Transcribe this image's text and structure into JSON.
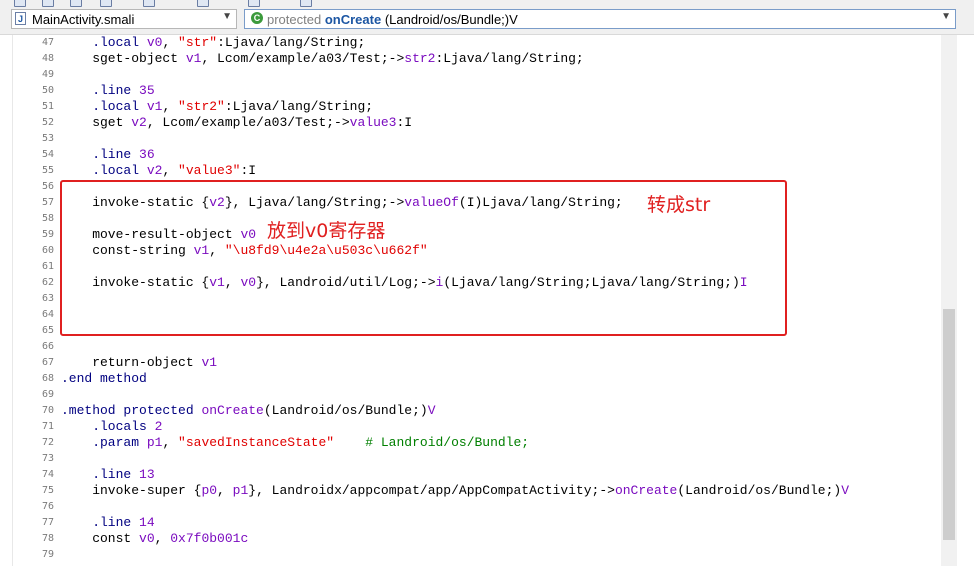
{
  "file_tab": {
    "name": "MainActivity.smali",
    "icon": "java-file-icon"
  },
  "method_selector": {
    "modifier": "protected",
    "method": "onCreate",
    "signature": "(Landroid/os/Bundle;)V"
  },
  "lines": [
    {
      "num": "47",
      "segs": [
        [
          "k",
          "    .local "
        ],
        [
          "t",
          "v0"
        ],
        [
          "p",
          ", "
        ],
        [
          "s",
          "\"str\""
        ],
        [
          "p",
          ":Ljava/lang/String;"
        ]
      ]
    },
    {
      "num": "48",
      "segs": [
        [
          "p",
          "    sget-object "
        ],
        [
          "t",
          "v1"
        ],
        [
          "p",
          ", Lcom/example/a03/Test;->"
        ],
        [
          "t",
          "str2"
        ],
        [
          "p",
          ":Ljava/lang/String;"
        ]
      ]
    },
    {
      "num": "49",
      "segs": []
    },
    {
      "num": "50",
      "segs": [
        [
          "k",
          "    .line "
        ],
        [
          "t",
          "35"
        ]
      ]
    },
    {
      "num": "51",
      "segs": [
        [
          "k",
          "    .local "
        ],
        [
          "t",
          "v1"
        ],
        [
          "p",
          ", "
        ],
        [
          "s",
          "\"str2\""
        ],
        [
          "p",
          ":Ljava/lang/String;"
        ]
      ]
    },
    {
      "num": "52",
      "segs": [
        [
          "p",
          "    sget "
        ],
        [
          "t",
          "v2"
        ],
        [
          "p",
          ", Lcom/example/a03/Test;->"
        ],
        [
          "t",
          "value3"
        ],
        [
          "p",
          ":I"
        ]
      ]
    },
    {
      "num": "53",
      "segs": []
    },
    {
      "num": "54",
      "segs": [
        [
          "k",
          "    .line "
        ],
        [
          "t",
          "36"
        ]
      ]
    },
    {
      "num": "55",
      "segs": [
        [
          "k",
          "    .local "
        ],
        [
          "t",
          "v2"
        ],
        [
          "p",
          ", "
        ],
        [
          "s",
          "\"value3\""
        ],
        [
          "p",
          ":I"
        ]
      ]
    },
    {
      "num": "56",
      "segs": []
    },
    {
      "num": "57",
      "segs": [
        [
          "p",
          "    invoke-static {"
        ],
        [
          "t",
          "v2"
        ],
        [
          "p",
          "}, Ljava/lang/String;->"
        ],
        [
          "t",
          "valueOf"
        ],
        [
          "p",
          "(I)Ljava/lang/String;"
        ]
      ]
    },
    {
      "num": "58",
      "segs": []
    },
    {
      "num": "59",
      "segs": [
        [
          "p",
          "    move-result-object "
        ],
        [
          "t",
          "v0"
        ]
      ]
    },
    {
      "num": "60",
      "segs": [
        [
          "p",
          "    const-string "
        ],
        [
          "t",
          "v1"
        ],
        [
          "p",
          ", "
        ],
        [
          "s",
          "\"\\u8fd9\\u4e2a\\u503c\\u662f\""
        ]
      ]
    },
    {
      "num": "61",
      "segs": []
    },
    {
      "num": "62",
      "segs": [
        [
          "p",
          "    invoke-static {"
        ],
        [
          "t",
          "v1"
        ],
        [
          "p",
          ", "
        ],
        [
          "t",
          "v0"
        ],
        [
          "p",
          "}, Landroid/util/Log;->"
        ],
        [
          "t",
          "i"
        ],
        [
          "p",
          "(Ljava/lang/String;Ljava/lang/String;)"
        ],
        [
          "t",
          "I"
        ]
      ]
    },
    {
      "num": "63",
      "segs": []
    },
    {
      "num": "64",
      "segs": []
    },
    {
      "num": "65",
      "segs": []
    },
    {
      "num": "66",
      "segs": []
    },
    {
      "num": "67",
      "segs": [
        [
          "p",
          "    return-object "
        ],
        [
          "t",
          "v1"
        ]
      ]
    },
    {
      "num": "68",
      "segs": [
        [
          "k",
          ".end method"
        ]
      ]
    },
    {
      "num": "69",
      "segs": []
    },
    {
      "num": "70",
      "segs": [
        [
          "k",
          ".method protected "
        ],
        [
          "t",
          "onCreate"
        ],
        [
          "p",
          "(Landroid/os/Bundle;)"
        ],
        [
          "t",
          "V"
        ]
      ]
    },
    {
      "num": "71",
      "segs": [
        [
          "k",
          "    .locals "
        ],
        [
          "t",
          "2"
        ]
      ]
    },
    {
      "num": "72",
      "segs": [
        [
          "k",
          "    .param "
        ],
        [
          "t",
          "p1"
        ],
        [
          "p",
          ", "
        ],
        [
          "s",
          "\"savedInstanceState\""
        ],
        [
          "c",
          "    # Landroid/os/Bundle;"
        ]
      ]
    },
    {
      "num": "73",
      "segs": []
    },
    {
      "num": "74",
      "segs": [
        [
          "k",
          "    .line "
        ],
        [
          "t",
          "13"
        ]
      ]
    },
    {
      "num": "75",
      "segs": [
        [
          "p",
          "    invoke-super {"
        ],
        [
          "t",
          "p0"
        ],
        [
          "p",
          ", "
        ],
        [
          "t",
          "p1"
        ],
        [
          "p",
          "}, Landroidx/appcompat/app/AppCompatActivity;->"
        ],
        [
          "t",
          "onCreate"
        ],
        [
          "p",
          "(Landroid/os/Bundle;)"
        ],
        [
          "t",
          "V"
        ]
      ]
    },
    {
      "num": "76",
      "segs": []
    },
    {
      "num": "77",
      "segs": [
        [
          "k",
          "    .line "
        ],
        [
          "t",
          "14"
        ]
      ]
    },
    {
      "num": "78",
      "segs": [
        [
          "p",
          "    const "
        ],
        [
          "t",
          "v0"
        ],
        [
          "p",
          ", "
        ],
        [
          "t",
          "0x7f0b001c"
        ]
      ]
    },
    {
      "num": "79",
      "segs": []
    }
  ],
  "annotations": {
    "to_str": "转成str",
    "to_v0": "放到v0寄存器"
  },
  "colors": {
    "keyword": "#000080",
    "string": "#e00000",
    "token": "#7a0bbf",
    "comment": "#007f00",
    "highlight": "#e02020"
  }
}
